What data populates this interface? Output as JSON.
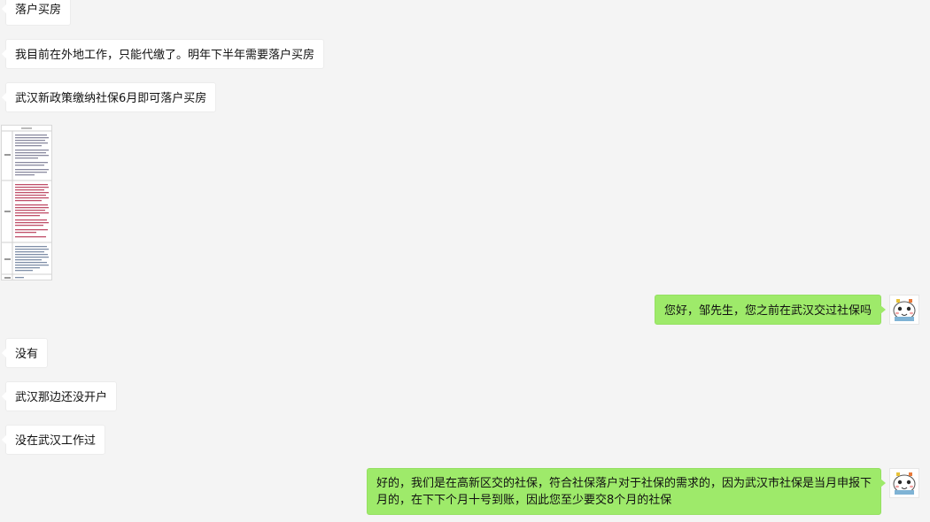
{
  "messages": [
    {
      "side": "left",
      "text": "落户买房"
    },
    {
      "side": "left",
      "text": "我目前在外地工作，只能代缴了。明年下半年需要落户买房"
    },
    {
      "side": "left",
      "text": "武汉新政策缴纳社保6月即可落户买房"
    },
    {
      "side": "left",
      "type": "image",
      "description": "policy-document-thumbnail"
    },
    {
      "side": "right",
      "text": "您好，邹先生，您之前在武汉交过社保吗"
    },
    {
      "side": "left",
      "text": "没有"
    },
    {
      "side": "left",
      "text": "武汉那边还没开户"
    },
    {
      "side": "left",
      "text": "没在武汉工作过"
    },
    {
      "side": "right",
      "text": "好的，我们是在高新区交的社保，符合社保落户对于社保的需求的，因为武汉市社保是当月申报下月的，在下下个月十号到账，因此您至少要交8个月的社保"
    }
  ]
}
